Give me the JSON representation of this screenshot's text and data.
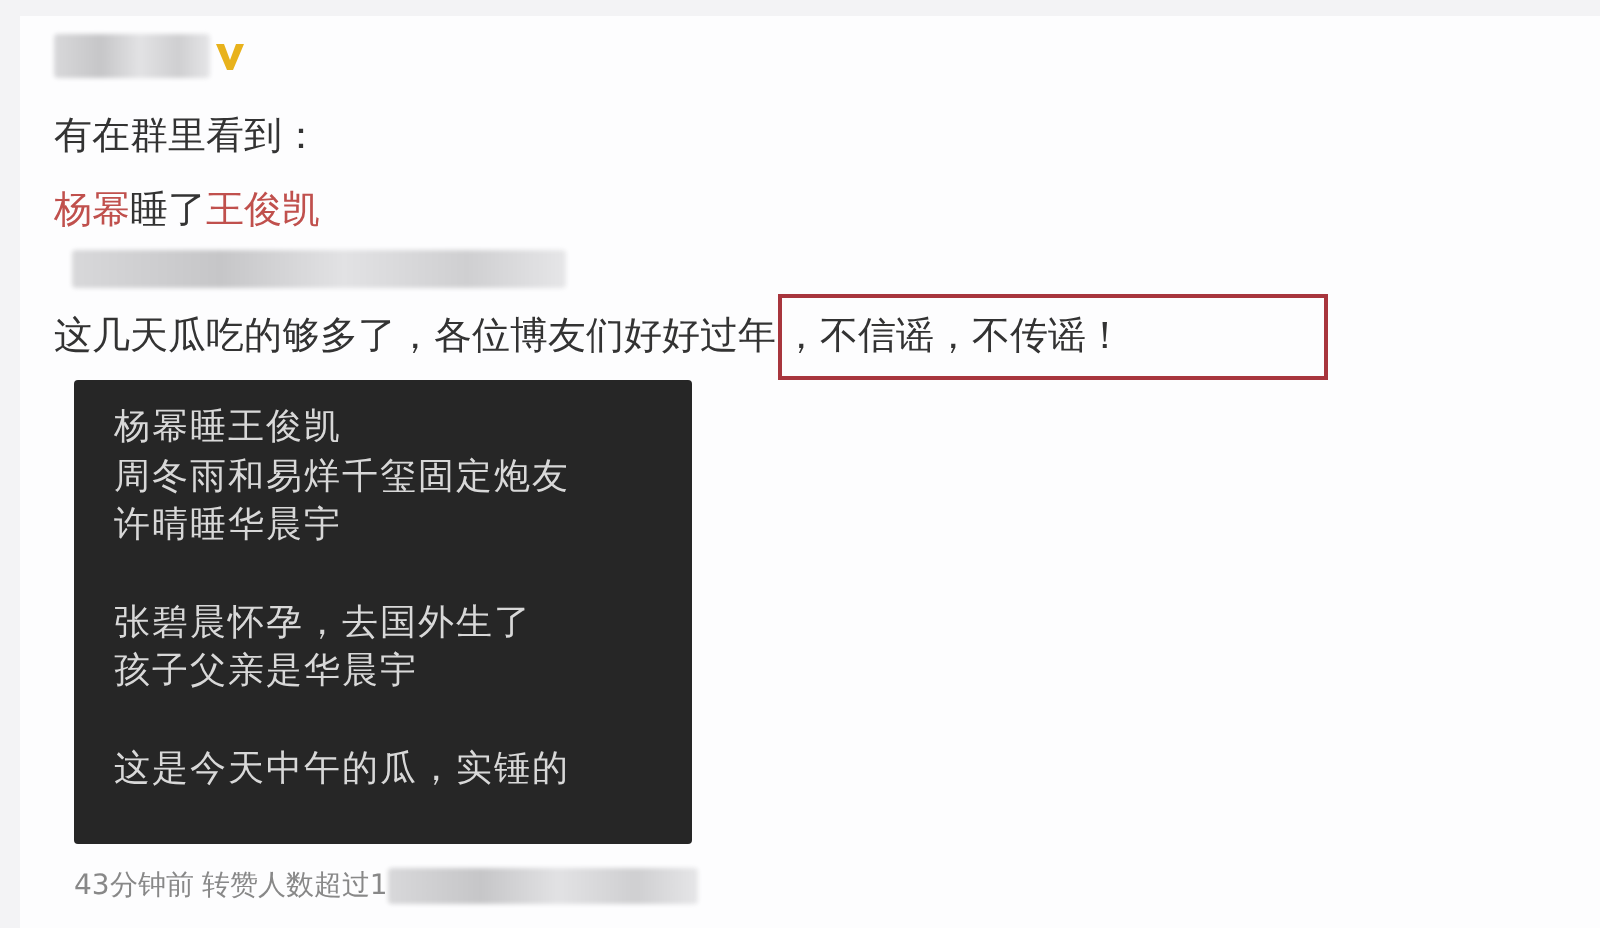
{
  "author": {
    "verified": true
  },
  "post": {
    "intro": "有在群里看到：",
    "headline": [
      {
        "text": "杨幂",
        "highlight": true
      },
      {
        "text": "睡了",
        "highlight": false
      },
      {
        "text": "王俊凯",
        "highlight": true
      }
    ],
    "comment": "这几天瓜吃的够多了，各位博友们好好过年",
    "comment_boxed": "，不信谣，不传谣！",
    "screenshot": {
      "paragraphs": [
        [
          "杨幂睡王俊凯",
          "周冬雨和易烊千玺固定炮友",
          "许晴睡华晨宇"
        ],
        [
          "张碧晨怀孕，去国外生了",
          "孩子父亲是华晨宇"
        ],
        [
          "这是今天中午的瓜，实锤的"
        ]
      ]
    }
  },
  "footer": {
    "time": "43分钟前",
    "stats": "转赞人数超过1"
  }
}
